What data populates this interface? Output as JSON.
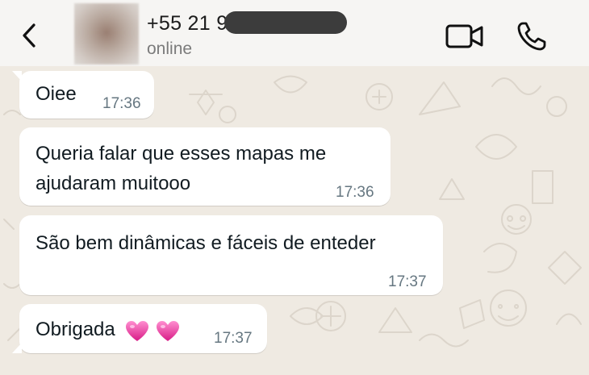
{
  "header": {
    "contact_name": "+55 21 9",
    "status": "online",
    "icons": {
      "back": "chevron-left-icon",
      "video": "video-camera-icon",
      "call": "phone-icon"
    }
  },
  "messages": [
    {
      "text": "Oiee",
      "time": "17:36"
    },
    {
      "lines": [
        "Queria falar que esses mapas me",
        "ajudaram muitooo"
      ],
      "time": "17:36"
    },
    {
      "text": "São bem dinâmicas e fáceis de enteder",
      "time": "17:37"
    },
    {
      "text": "Obrigada",
      "emoji": [
        "pink-heart",
        "pink-heart"
      ],
      "time": "17:37"
    }
  ],
  "colors": {
    "background": "#efeae2",
    "header": "#f6f5f3",
    "bubble": "#ffffff",
    "timestamp": "#667781",
    "heart": "#e5399b"
  }
}
